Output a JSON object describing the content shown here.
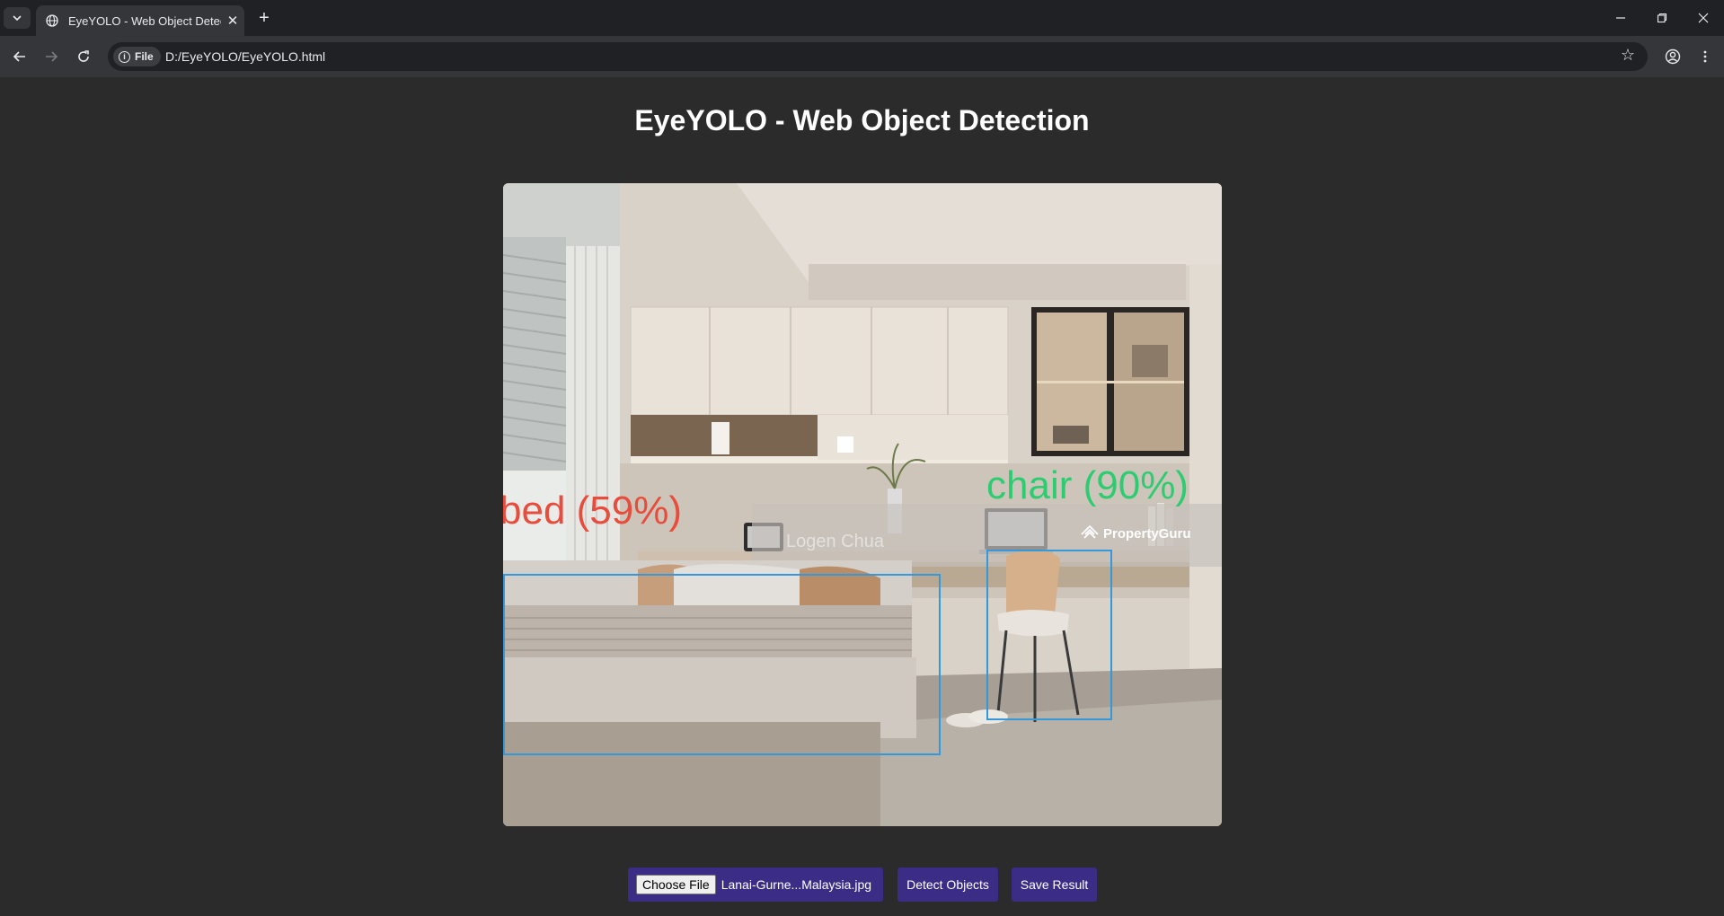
{
  "browser": {
    "tab_title": "EyeYOLO - Web Object Detection",
    "tab_close": "✕",
    "new_tab": "+",
    "security_chip": "File",
    "url": "D:/EyeYOLO/EyeYOLO.html"
  },
  "page": {
    "heading": "EyeYOLO - Web Object Detection",
    "detections": [
      {
        "label": "bed (59%)",
        "color": "#e74c3c",
        "box_color": "#3498db"
      },
      {
        "label": "chair (90%)",
        "color": "#2ecc71",
        "box_color": "#3498db"
      }
    ],
    "watermarks": [
      "Logen Chua",
      "PropertyGuru"
    ],
    "controls": {
      "choose_file": "Choose File",
      "file_name": "Lanai-Gurne...Malaysia.jpg",
      "detect": "Detect Objects",
      "save": "Save Result"
    },
    "colors": {
      "page_bg": "#2b2b2b",
      "button_bg": "#3b2c86"
    }
  }
}
